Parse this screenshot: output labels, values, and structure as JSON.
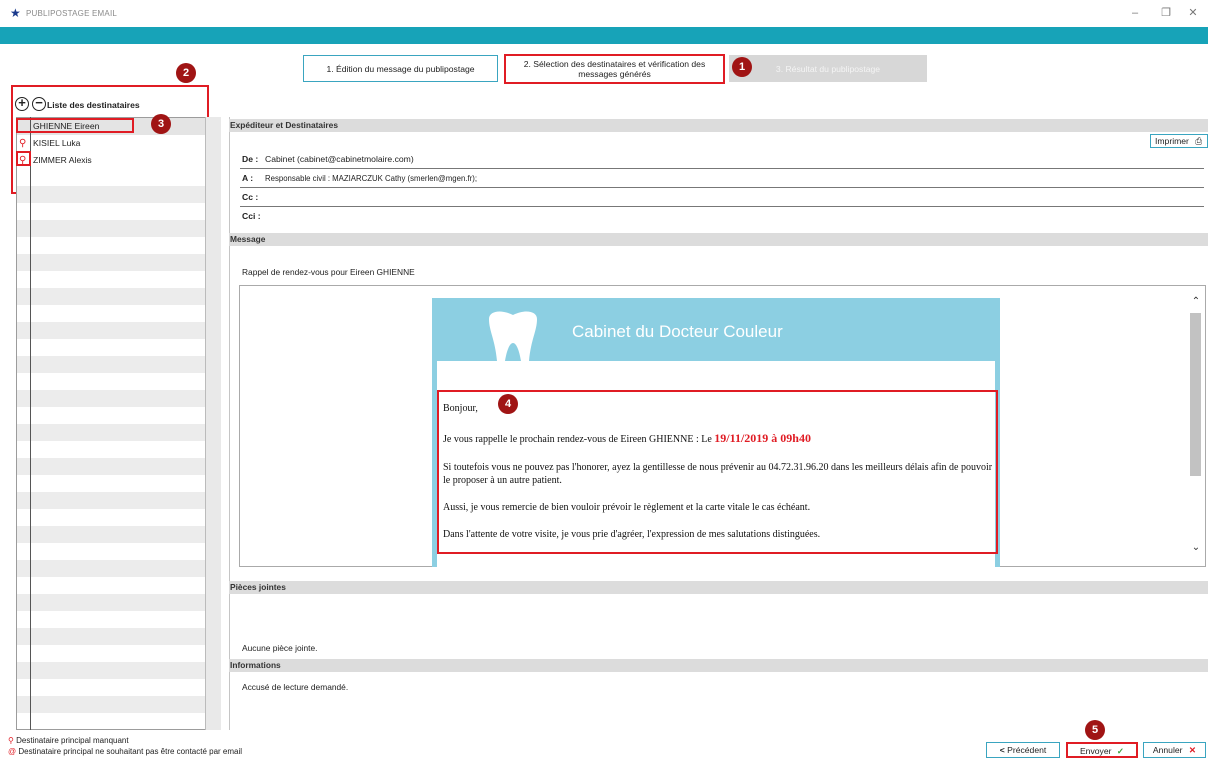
{
  "window": {
    "title": "PUBLIPOSTAGE EMAIL",
    "minimize": "–",
    "maximize": "❐",
    "close": "✕"
  },
  "steps": [
    {
      "label": "1. Édition du message du publipostage"
    },
    {
      "label": "2. Sélection des destinataires et vérification des messages générés"
    },
    {
      "label": "3. Résultat du publipostage"
    }
  ],
  "badges": {
    "b1": "1",
    "b2": "2",
    "b3": "3",
    "b4": "4",
    "b5": "5"
  },
  "recipients": {
    "title": "Liste des destinataires",
    "add_icon": "plus-circle-icon",
    "remove_icon": "minus-circle-icon",
    "items": [
      {
        "name": "GHIENNE Eireen",
        "icon": ""
      },
      {
        "name": "KISIEL Luka",
        "icon": "person-icon"
      },
      {
        "name": "ZIMMER Alexis",
        "icon": "person-icon"
      }
    ]
  },
  "sender_section": {
    "header": "Expéditeur et Destinataires",
    "print_label": "Imprimer",
    "from_label": "De :",
    "from_value": "Cabinet (cabinet@cabinetmolaire.com)",
    "to_label": "A :",
    "to_value": "Responsable civil : MAZIARCZUK Cathy (smerlen@mgen.fr);",
    "cc_label": "Cc :",
    "bcc_label": "Cci :"
  },
  "message_section": {
    "header": "Message",
    "subject": "Rappel de rendez-vous pour Eireen GHIENNE",
    "clinic_name": "Cabinet du Docteur Couleur",
    "greeting": "Bonjour,",
    "line1_text": "Je vous rappelle le prochain rendez-vous de Eireen GHIENNE : Le ",
    "line1_date": "19/11/2019 à 09h40",
    "line2": "Si toutefois vous ne pouvez pas l'honorer, ayez la gentillesse de nous prévenir au 04.72.31.96.20 dans les meilleurs délais afin de pouvoir le proposer à un autre patient.",
    "line3": "Aussi, je vous remercie de bien vouloir prévoir le règlement et la carte vitale le cas échéant.",
    "line4": "Dans l'attente de votre visite, je vous prie d'agréer,  l'expression de mes salutations distinguées."
  },
  "attachments_section": {
    "header": "Pièces jointes",
    "empty_text": "Aucune pièce jointe."
  },
  "info_section": {
    "header": "Informations",
    "text": "Accusé de lecture demandé."
  },
  "legend": {
    "missing": "Destinataire principal manquant",
    "no_email": "Destinataire principal ne souhaitant pas être contacté par email"
  },
  "buttons": {
    "previous": "Précédent",
    "send": "Envoyer",
    "cancel": "Annuler"
  },
  "colors": {
    "accent": "#17a3b8",
    "highlight": "#e01c24",
    "badge": "#a01414",
    "email_header": "#8ccfe2"
  }
}
